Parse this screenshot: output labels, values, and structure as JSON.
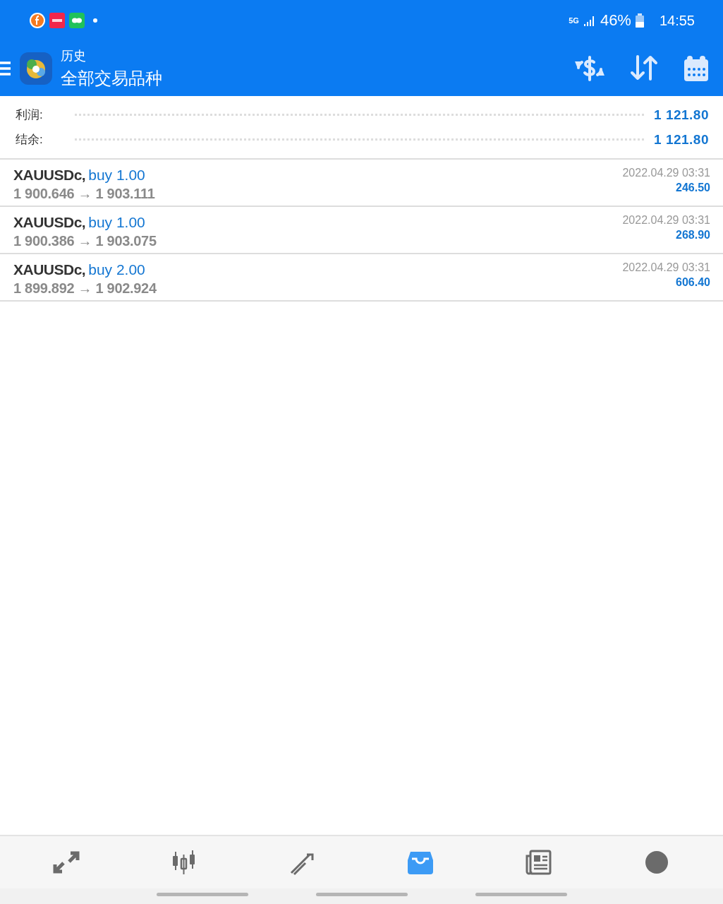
{
  "status_bar": {
    "network": "5G",
    "battery": "46%",
    "time": "14:55"
  },
  "header": {
    "title": "历史",
    "subtitle": "全部交易品种"
  },
  "summary": [
    {
      "label": "利润:",
      "value": "1 121.80"
    },
    {
      "label": "结余:",
      "value": "1 121.80"
    }
  ],
  "deals": [
    {
      "symbol": "XAUUSDc,",
      "side": "buy 1.00",
      "prices": "1 900.646 → 1 903.111",
      "time": "2022.04.29 03:31",
      "profit": "246.50"
    },
    {
      "symbol": "XAUUSDc,",
      "side": "buy 1.00",
      "prices": "1 900.386 → 1 903.075",
      "time": "2022.04.29 03:31",
      "profit": "268.90"
    },
    {
      "symbol": "XAUUSDc,",
      "side": "buy 2.00",
      "prices": "1 899.892 → 1 902.924",
      "time": "2022.04.29 03:31",
      "profit": "606.40"
    }
  ],
  "bottom_nav": [
    {
      "kind": "quotes",
      "selected": false
    },
    {
      "kind": "chart",
      "selected": false
    },
    {
      "kind": "trade",
      "selected": false
    },
    {
      "kind": "history",
      "selected": true
    },
    {
      "kind": "news",
      "selected": false
    },
    {
      "kind": "more",
      "selected": false
    }
  ]
}
